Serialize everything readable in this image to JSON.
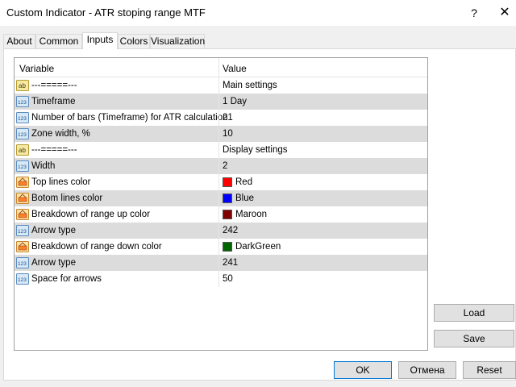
{
  "window": {
    "title": "Custom Indicator - ATR stoping range MTF",
    "help_label": "?",
    "close_label": "✕"
  },
  "tabs": [
    {
      "label": "About"
    },
    {
      "label": "Common"
    },
    {
      "label": "Inputs"
    },
    {
      "label": "Colors"
    },
    {
      "label": "Visualization"
    }
  ],
  "active_tab": "Inputs",
  "table": {
    "columns": [
      "Variable",
      "Value"
    ],
    "rows": [
      {
        "type": "string",
        "name": "---=====---",
        "value": "Main settings"
      },
      {
        "type": "int",
        "name": "Timeframe",
        "value": "1 Day"
      },
      {
        "type": "int",
        "name": "Number of bars (Timeframe) for ATR calculation",
        "value": "21"
      },
      {
        "type": "int",
        "name": "Zone width, %",
        "value": "10"
      },
      {
        "type": "string",
        "name": "---=====---",
        "value": "Display settings"
      },
      {
        "type": "int",
        "name": "Width",
        "value": "2"
      },
      {
        "type": "color",
        "name": "Top lines color",
        "value": "Red",
        "color": "#ff0000"
      },
      {
        "type": "color",
        "name": "Botom lines color",
        "value": "Blue",
        "color": "#0000ff"
      },
      {
        "type": "color",
        "name": "Breakdown of range up color",
        "value": "Maroon",
        "color": "#800000"
      },
      {
        "type": "int",
        "name": "Arrow type",
        "value": "242"
      },
      {
        "type": "color",
        "name": "Breakdown of range down color",
        "value": "DarkGreen",
        "color": "#006400"
      },
      {
        "type": "int",
        "name": "Arrow type",
        "value": "241"
      },
      {
        "type": "int",
        "name": "Space for arrows",
        "value": "50"
      }
    ]
  },
  "side_buttons": {
    "load": "Load",
    "save": "Save"
  },
  "footer_buttons": {
    "ok": "OK",
    "cancel": "Отмена",
    "reset": "Reset"
  }
}
